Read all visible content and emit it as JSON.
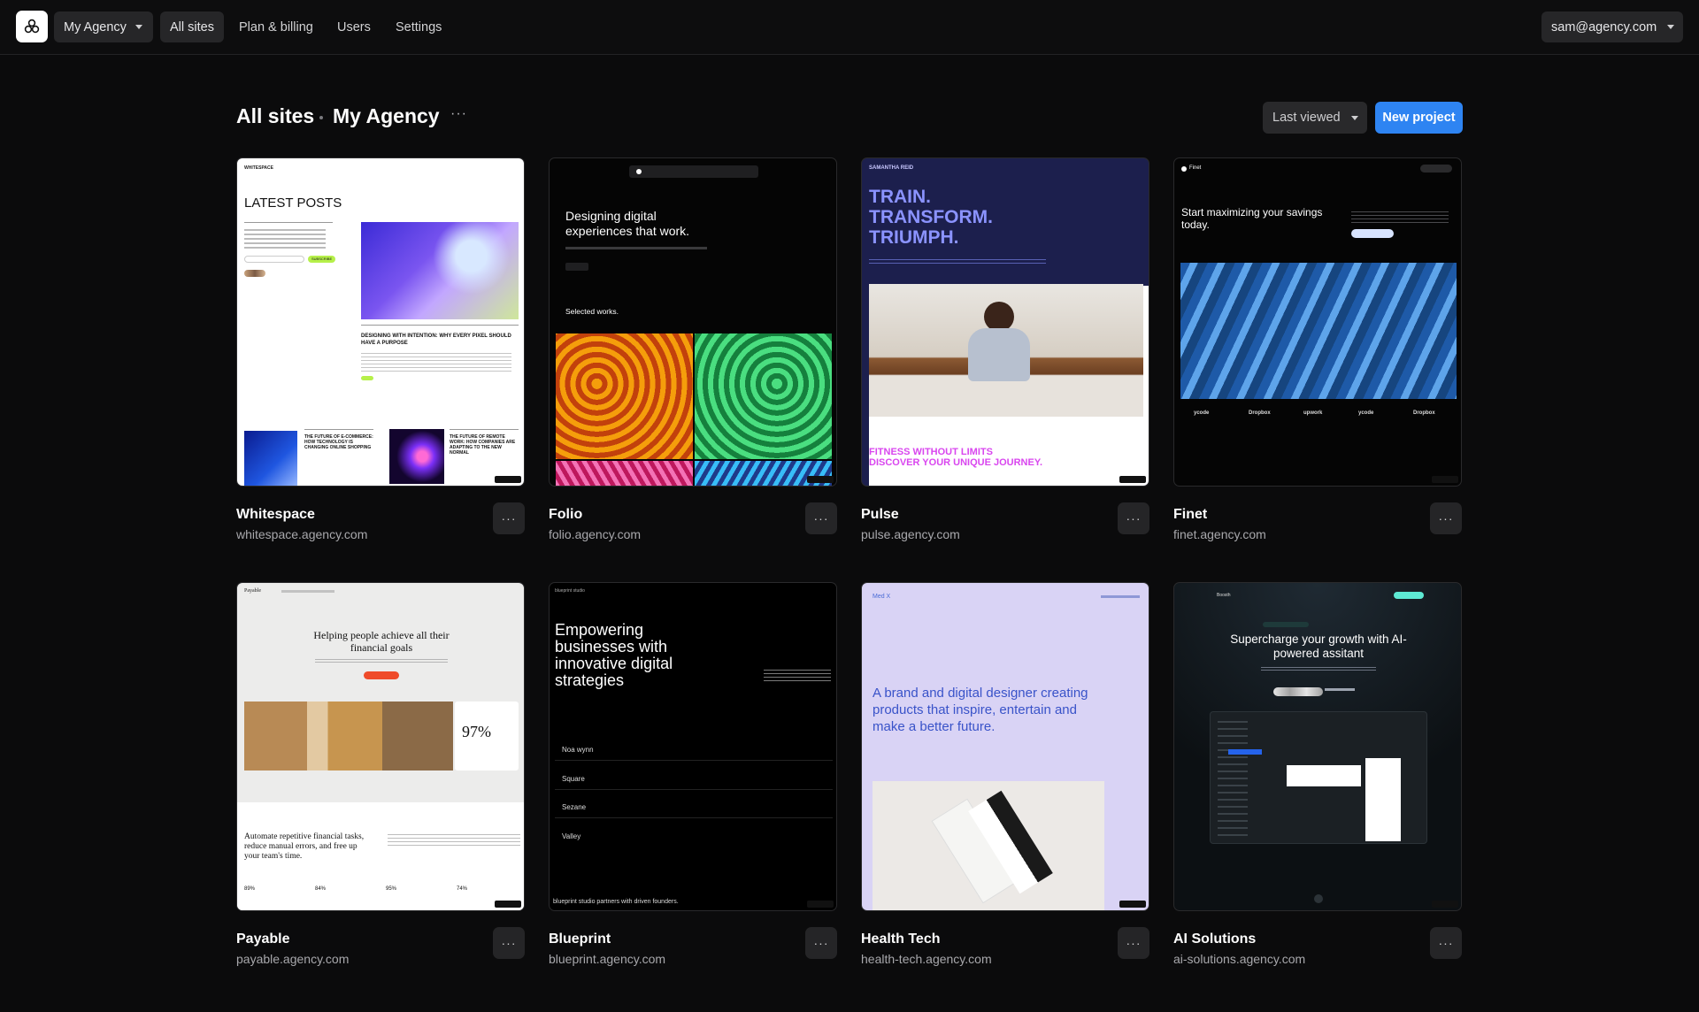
{
  "nav": {
    "workspace": "My Agency",
    "items": [
      "All sites",
      "Plan & billing",
      "Users",
      "Settings"
    ],
    "account": "sam@agency.com"
  },
  "header": {
    "crumb_root": "All sites",
    "crumb_current": "My Agency",
    "more": "···",
    "sort_label": "Last viewed",
    "new_project": "New project"
  },
  "sites": [
    {
      "name": "Whitespace",
      "url": "whitespace.agency.com"
    },
    {
      "name": "Folio",
      "url": "folio.agency.com"
    },
    {
      "name": "Pulse",
      "url": "pulse.agency.com"
    },
    {
      "name": "Finet",
      "url": "finet.agency.com"
    },
    {
      "name": "Payable",
      "url": "payable.agency.com"
    },
    {
      "name": "Blueprint",
      "url": "blueprint.agency.com"
    },
    {
      "name": "Health Tech",
      "url": "health-tech.agency.com"
    },
    {
      "name": "AI Solutions",
      "url": "ai-solutions.agency.com"
    }
  ],
  "card_more": "···",
  "previews": {
    "whitespace": {
      "brand": "WHITESPACE",
      "heading": "LATEST POSTS",
      "post": "DESIGNING WITH INTENTION: WHY EVERY PIXEL SHOULD HAVE A PURPOSE",
      "post2": "THE FUTURE OF E-COMMERCE: HOW TECHNOLOGY IS CHANGING ONLINE SHOPPING",
      "post3": "THE FUTURE OF REMOTE WORK: HOW COMPANIES ARE ADAPTING TO THE NEW NORMAL",
      "subscribe": "SUBSCRIBE"
    },
    "folio": {
      "headline": "Designing digital experiences that work.",
      "section": "Selected works."
    },
    "pulse": {
      "brand": "SAMANTHA REID",
      "headline": "TRAIN. TRANSFORM. TRIUMPH.",
      "tagline": "FITNESS WITHOUT LIMITS DISCOVER YOUR UNIQUE JOURNEY."
    },
    "finet": {
      "brand": "Finet",
      "headline": "Start maximizing your savings today.",
      "logos": [
        "ycode",
        "Dropbox",
        "upwork",
        "ycode",
        "Dropbox"
      ]
    },
    "payable": {
      "brand": "Payable",
      "headline": "Helping people achieve all their financial goals",
      "stat": "97%",
      "lower": "Automate repetitive financial tasks, reduce manual errors, and free up your team's time.",
      "metrics": [
        "89%",
        "84%",
        "95%",
        "74%"
      ]
    },
    "blueprint": {
      "brand": "blueprint studio",
      "headline": "Empowering businesses with innovative digital strategies",
      "list": [
        "Noa wynn",
        "Square",
        "Sezane",
        "Valley"
      ],
      "footer": "blueprint studio partners with driven founders."
    },
    "healthtech": {
      "brand": "Med X",
      "headline": "A brand and digital designer creating products that inspire, entertain and make a better future."
    },
    "ai": {
      "brand": "Boosth",
      "headline": "Supercharge your growth with AI-powered assitant"
    }
  },
  "colors": {
    "accent": "#2e84f2",
    "background": "#0b0b0c",
    "pulse_pink": "#d946ef",
    "pulse_navy": "#1c1f4d",
    "health_lilac": "#d9d3f5",
    "blueprint_bg": "#000000"
  }
}
